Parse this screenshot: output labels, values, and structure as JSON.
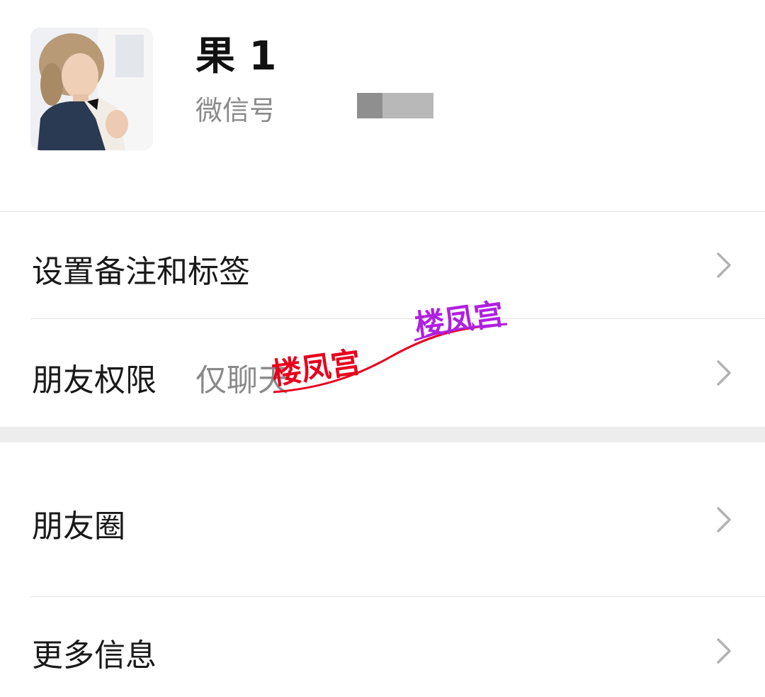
{
  "profile": {
    "nickname": "果 1",
    "wxid_label": "微信号",
    "avatar": "contact-avatar-photo"
  },
  "rows": [
    {
      "label": "设置备注和标签",
      "value": "",
      "icon": "chevron-right-icon"
    },
    {
      "label": "朋友权限",
      "value": "仅聊天",
      "icon": "chevron-right-icon"
    },
    {
      "label": "朋友圈",
      "value": "",
      "icon": "chevron-right-icon"
    },
    {
      "label": "更多信息",
      "value": "",
      "icon": "chevron-right-icon"
    }
  ],
  "watermark": {
    "text_primary": "楼凤宫",
    "text_secondary": "楼凤宫",
    "colors": {
      "primary": "#e8001c",
      "secondary": "#b020e0"
    }
  },
  "colors": {
    "text_primary": "#191919",
    "text_secondary": "#8a8a8a",
    "divider": "#e4e4e4",
    "section_gap": "#ededed",
    "chevron": "#b2b2b2"
  }
}
